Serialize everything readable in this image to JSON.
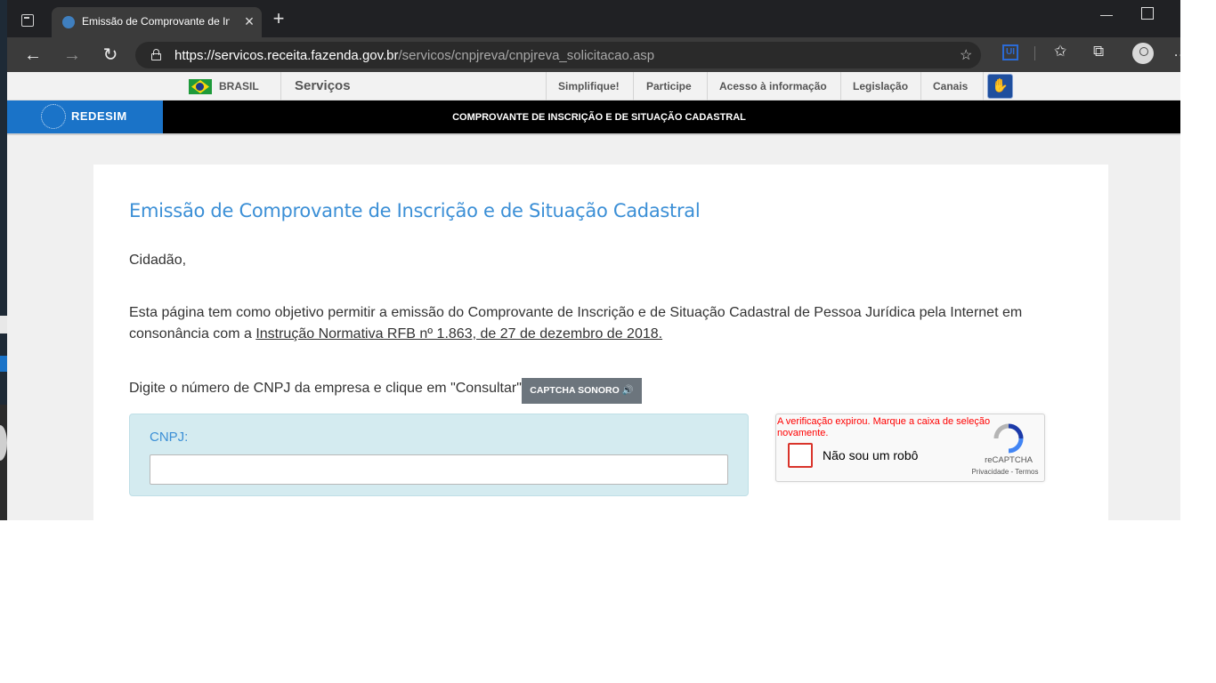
{
  "browser": {
    "tab_title": "Emissão de Comprovante de Inscrição e de Situação Cadastral",
    "tab_close": "×",
    "new_tab": "+",
    "url_host": "https://servicos.receita.fazenda.gov.br",
    "url_path": "/servicos/cnpjreva/cnpjreva_solicitacao.asp",
    "icons": [
      "tab-actions-icon",
      "back-icon",
      "forward-icon",
      "refresh-icon",
      "lock-icon",
      "add-favorite-icon",
      "extension-icon",
      "favorites-icon",
      "collections-icon",
      "profile-icon",
      "more-icon",
      "minimize-icon",
      "maximize-icon"
    ]
  },
  "govbar": {
    "brasil": "BRASIL",
    "servicos": "Serviços",
    "links": [
      "Simplifique!",
      "Participe",
      "Acesso à informação",
      "Legislação",
      "Canais"
    ]
  },
  "redesim": {
    "logo": "REDESIM",
    "title": "COMPROVANTE DE INSCRIÇÃO E DE SITUAÇÃO CADASTRAL",
    "brand_color": "#1a73c8"
  },
  "main": {
    "title": "Emissão de Comprovante de Inscrição e de Situação Cadastral",
    "greeting": "Cidadão,",
    "intro": "Esta página tem como objetivo permitir a emissão do Comprovante de Inscrição e de Situação Cadastral de Pessoa Jurídica pela Internet em consonância com a ",
    "intro_link": "Instrução Normativa RFB nº 1.863, de 27 de dezembro de 2018.",
    "instruction": "Digite o número de CNPJ da empresa e clique em \"Consultar\".",
    "captcha_audio_button": "CAPTCHA SONORO 🔊",
    "cnpj_label": "CNPJ:",
    "cnpj_value": ""
  },
  "recaptcha": {
    "error": "A verificação expirou. Marque a caixa de seleção novamente.",
    "label": "Não sou um robô",
    "brand": "reCAPTCHA",
    "terms": "Privacidade - Termos",
    "error_color": "#ff0000"
  }
}
